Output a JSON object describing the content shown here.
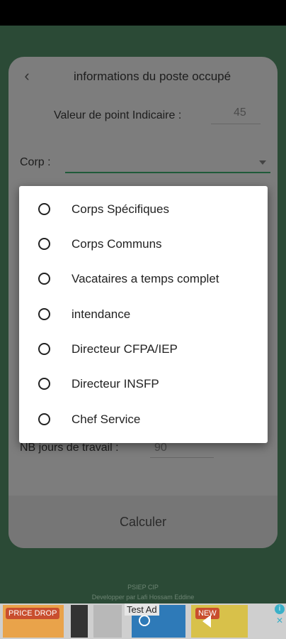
{
  "card": {
    "title": "informations du poste occupé",
    "point_indiciaire_label": "Valeur de point Indicaire :",
    "point_indiciaire_value": "45",
    "corp_label": "Corp :",
    "nb_jours_label": "NB jours de travail :",
    "nb_jours_value": "90",
    "calc_button": "Calculer"
  },
  "dialog": {
    "options": [
      "Corps Spécifiques",
      "Corps Communs",
      "Vacataires a temps complet",
      "intendance",
      "Directeur CFPA/IEP",
      "Directeur INSFP",
      "Chef Service"
    ],
    "selected_index": null
  },
  "footer": {
    "line1": "PSIEP CIP",
    "line2": "Developper par Lafi Hossam Eddine"
  },
  "ad": {
    "label": "Test Ad",
    "badge_left": "PRICE DROP",
    "badge_right": "NEW"
  },
  "colors": {
    "app_background": "#2b4a36",
    "accent_underline": "#1f5a3a",
    "dialog_background": "#ffffff"
  }
}
